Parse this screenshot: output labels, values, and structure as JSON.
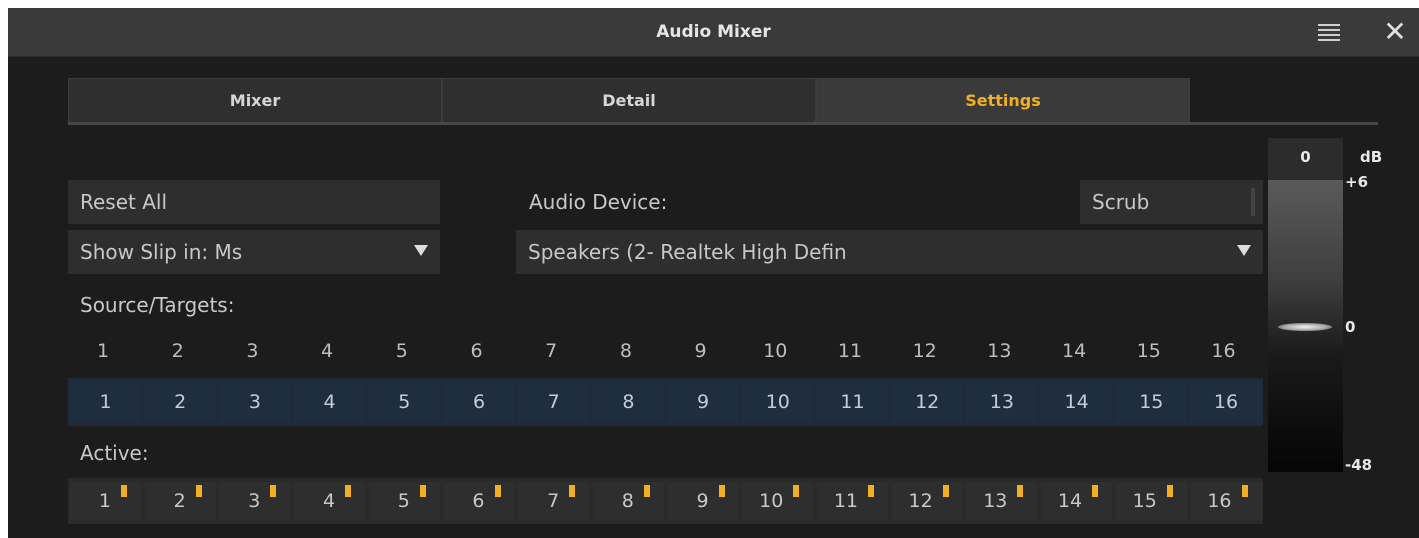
{
  "window": {
    "title": "Audio Mixer"
  },
  "tabs": [
    {
      "label": "Mixer",
      "active": false
    },
    {
      "label": "Detail",
      "active": false
    },
    {
      "label": "Settings",
      "active": true
    }
  ],
  "settings": {
    "reset_all_label": "Reset All",
    "show_slip_value": "Show Slip in: Ms",
    "audio_device_label": "Audio Device:",
    "audio_device_value": "Speakers (2- Realtek High Defin",
    "scrub_label": "Scrub",
    "source_targets_label": "Source/Targets:",
    "active_label": "Active:"
  },
  "channels": [
    "1",
    "2",
    "3",
    "4",
    "5",
    "6",
    "7",
    "8",
    "9",
    "10",
    "11",
    "12",
    "13",
    "14",
    "15",
    "16"
  ],
  "routing": [
    "1",
    "2",
    "3",
    "4",
    "5",
    "6",
    "7",
    "8",
    "9",
    "10",
    "11",
    "12",
    "13",
    "14",
    "15",
    "16"
  ],
  "active_channels": [
    "1",
    "2",
    "3",
    "4",
    "5",
    "6",
    "7",
    "8",
    "9",
    "10",
    "11",
    "12",
    "13",
    "14",
    "15",
    "16"
  ],
  "meter": {
    "level_readout": "0",
    "unit": "dB",
    "scale": [
      "+6",
      "0",
      "-48"
    ],
    "fader_db": 0
  },
  "colors": {
    "accent": "#f0b020",
    "background": "#1c1c1c",
    "routing_row": "#1d2b3a"
  },
  "icons": {
    "menu": "menu-lines-icon",
    "close": "close-icon"
  }
}
